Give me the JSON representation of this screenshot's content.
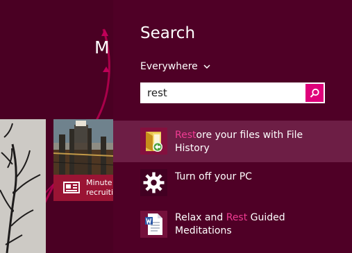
{
  "start_screen": {
    "title_fragment": "M",
    "news_tile": {
      "text_lines": [
        "Minute",
        "recruiti"
      ]
    },
    "icons": {
      "news": "news-icon"
    }
  },
  "search": {
    "heading": "Search",
    "scope": {
      "selected": "Everywhere"
    },
    "query": "rest",
    "button_icon": "magnifier-icon",
    "accent_color": "#df007a",
    "highlight_color": "#f03b93",
    "results": [
      {
        "highlight": "Rest",
        "rest": "ore your files with File History",
        "icon": "file-history-icon",
        "selected": true
      },
      {
        "title": "Turn off your PC",
        "icon": "power-settings-icon",
        "selected": false
      },
      {
        "before": "Relax and ",
        "highlight": "Rest",
        "after": " Guided Meditations",
        "icon": "word-document-icon",
        "selected": false
      }
    ]
  }
}
